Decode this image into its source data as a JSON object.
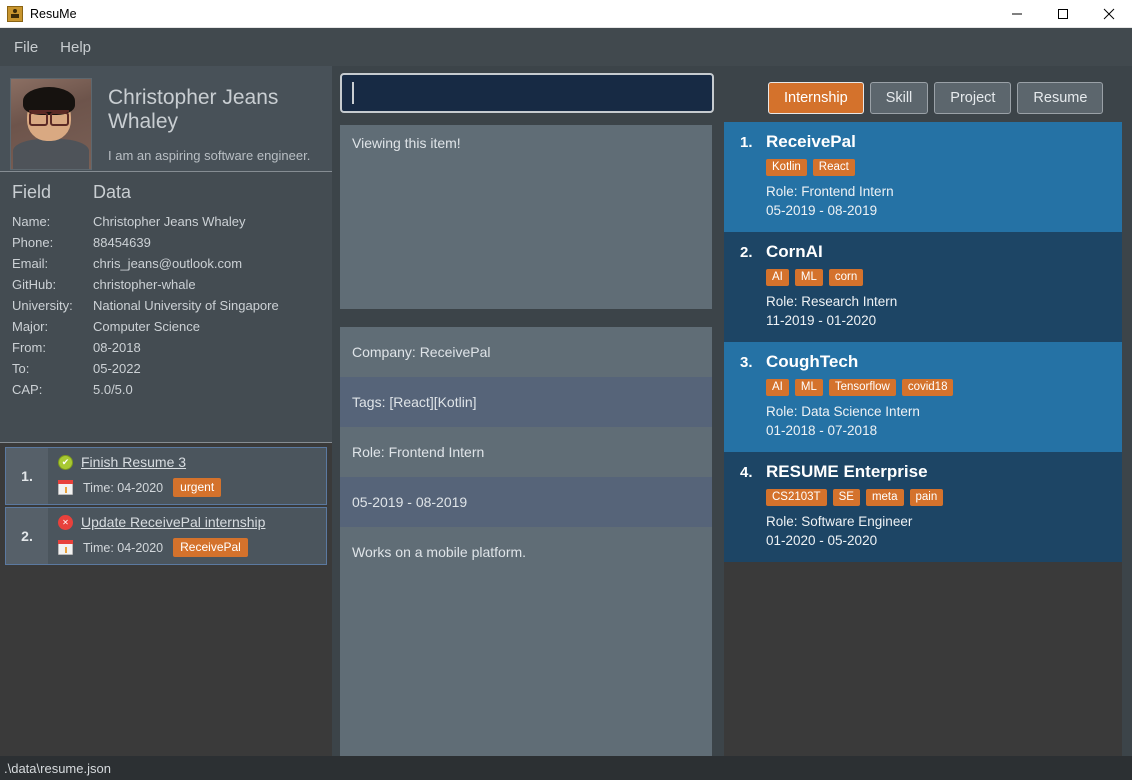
{
  "window": {
    "title": "ResuMe",
    "icon": "app-person-icon",
    "minimize": "minimize-icon",
    "maximize": "maximize-icon",
    "close": "close-icon"
  },
  "menu": {
    "items": [
      {
        "label": "File"
      },
      {
        "label": "Help"
      }
    ]
  },
  "profile": {
    "avatar_alt": "user-photo",
    "name": "Christopher Jeans Whaley",
    "tagline": "I am an aspiring software engineer."
  },
  "field_data": {
    "headers": {
      "field": "Field",
      "data": "Data"
    },
    "rows": [
      {
        "field": "Name:",
        "value": "Christopher Jeans Whaley"
      },
      {
        "field": "Phone:",
        "value": "88454639"
      },
      {
        "field": "Email:",
        "value": "chris_jeans@outlook.com"
      },
      {
        "field": "GitHub:",
        "value": "christopher-whale"
      },
      {
        "field": "University:",
        "value": "National University of Singapore"
      },
      {
        "field": "Major:",
        "value": "Computer Science"
      },
      {
        "field": "From:",
        "value": "08-2018"
      },
      {
        "field": "To:",
        "value": "05-2022"
      },
      {
        "field": "CAP:",
        "value": "5.0/5.0"
      }
    ]
  },
  "tasks": [
    {
      "number": "1.",
      "status_icon": "check-circle-icon",
      "status": "done",
      "title": "Finish Resume 3",
      "date_icon": "calendar-icon",
      "time": "Time: 04-2020",
      "chip": "urgent"
    },
    {
      "number": "2.",
      "status_icon": "cross-circle-icon",
      "status": "not-done",
      "title": "Update ReceivePal internship",
      "date_icon": "calendar-icon",
      "time": "Time: 04-2020",
      "chip": "ReceivePal"
    }
  ],
  "search": {
    "value": "",
    "placeholder": ""
  },
  "viewer": {
    "message": "Viewing this item!"
  },
  "detail_rows": [
    "Company: ReceivePal",
    "Tags: [React][Kotlin]",
    "Role: Frontend Intern",
    "05-2019 - 08-2019",
    "Works on a mobile platform."
  ],
  "tabs": [
    {
      "label": "Internship",
      "active": true
    },
    {
      "label": "Skill",
      "active": false
    },
    {
      "label": "Project",
      "active": false
    },
    {
      "label": "Resume",
      "active": false
    }
  ],
  "cards": [
    {
      "number": "1.",
      "title": "ReceivePal",
      "tags": [
        "Kotlin",
        "React"
      ],
      "role": "Role: Frontend Intern",
      "period": "05-2019 - 08-2019"
    },
    {
      "number": "2.",
      "title": "CornAI",
      "tags": [
        "AI",
        "ML",
        "corn"
      ],
      "role": "Role: Research Intern",
      "period": "11-2019 - 01-2020"
    },
    {
      "number": "3.",
      "title": "CoughTech",
      "tags": [
        "AI",
        "ML",
        "Tensorflow",
        "covid18"
      ],
      "role": "Role: Data Science Intern",
      "period": "01-2018 - 07-2018"
    },
    {
      "number": "4.",
      "title": "RESUME Enterprise",
      "tags": [
        "CS2103T",
        "SE",
        "meta",
        "pain"
      ],
      "role": "Role: Software Engineer",
      "period": "01-2020 - 05-2020"
    }
  ],
  "statusbar": {
    "path": ".\\data\\resume.json"
  },
  "colors": {
    "accent_orange": "#d4722c",
    "card_light_blue": "#2572a5",
    "card_dark_blue": "#1d4565",
    "panel_grey": "#3c4449",
    "detail_row_odd": "#606d76",
    "detail_row_even": "#566479",
    "search_bg": "#172a44",
    "done_green": "#a8c932",
    "undone_red": "#e8413c"
  }
}
